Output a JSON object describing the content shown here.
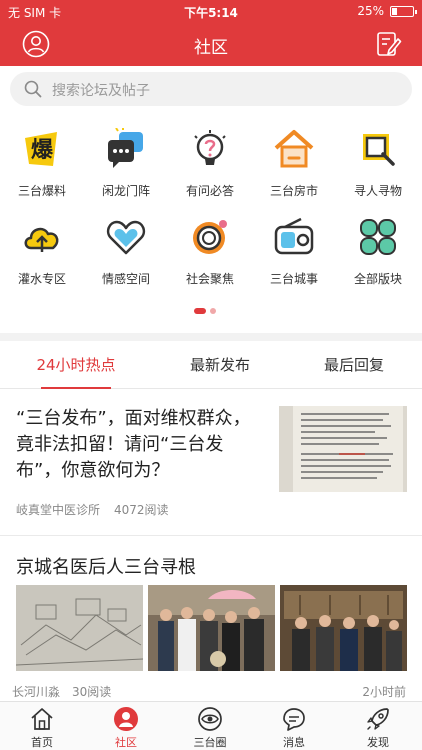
{
  "status_bar": {
    "carrier": "无 SIM 卡",
    "time": "下午5:14",
    "battery": "25%",
    "battery_level": 0.25
  },
  "nav": {
    "title": "社区",
    "left_icon": "profile-icon",
    "right_icon": "compose-icon"
  },
  "search": {
    "placeholder": "搜索论坛及帖子"
  },
  "categories": [
    {
      "label": "三台爆料",
      "icon": "fire-news-icon"
    },
    {
      "label": "闲龙门阵",
      "icon": "chat-bubbles-icon"
    },
    {
      "label": "有问必答",
      "icon": "lightbulb-icon"
    },
    {
      "label": "三台房市",
      "icon": "house-icon"
    },
    {
      "label": "寻人寻物",
      "icon": "search-square-icon"
    },
    {
      "label": "灌水专区",
      "icon": "cloud-upload-icon"
    },
    {
      "label": "情感空间",
      "icon": "heart-icon"
    },
    {
      "label": "社会聚焦",
      "icon": "focus-ring-icon"
    },
    {
      "label": "三台城事",
      "icon": "radio-icon"
    },
    {
      "label": "全部版块",
      "icon": "clover-grid-icon"
    }
  ],
  "pager": {
    "count": 2,
    "active": 0
  },
  "tabs": [
    {
      "label": "24小时热点",
      "active": true
    },
    {
      "label": "最新发布",
      "active": false
    },
    {
      "label": "最后回复",
      "active": false
    }
  ],
  "articles": [
    {
      "title": "“三台发布”，面对维权群众，竟非法扣留！请问“三台发布”，你意欲何为？",
      "author": "岐真堂中医诊所",
      "reads": "4072阅读"
    },
    {
      "title": "京城名医后人三台寻根",
      "author": "长河川淼",
      "reads": "30阅读",
      "time": "2小时前"
    }
  ],
  "tabbar": [
    {
      "label": "首页",
      "icon": "home-icon",
      "active": false
    },
    {
      "label": "社区",
      "icon": "community-icon",
      "active": true
    },
    {
      "label": "三台圈",
      "icon": "circle-eye-icon",
      "active": false
    },
    {
      "label": "消息",
      "icon": "message-icon",
      "active": false
    },
    {
      "label": "发现",
      "icon": "rocket-icon",
      "active": false
    }
  ],
  "colors": {
    "brand": "#e03a3c",
    "text": "#222222",
    "muted": "#888888"
  }
}
